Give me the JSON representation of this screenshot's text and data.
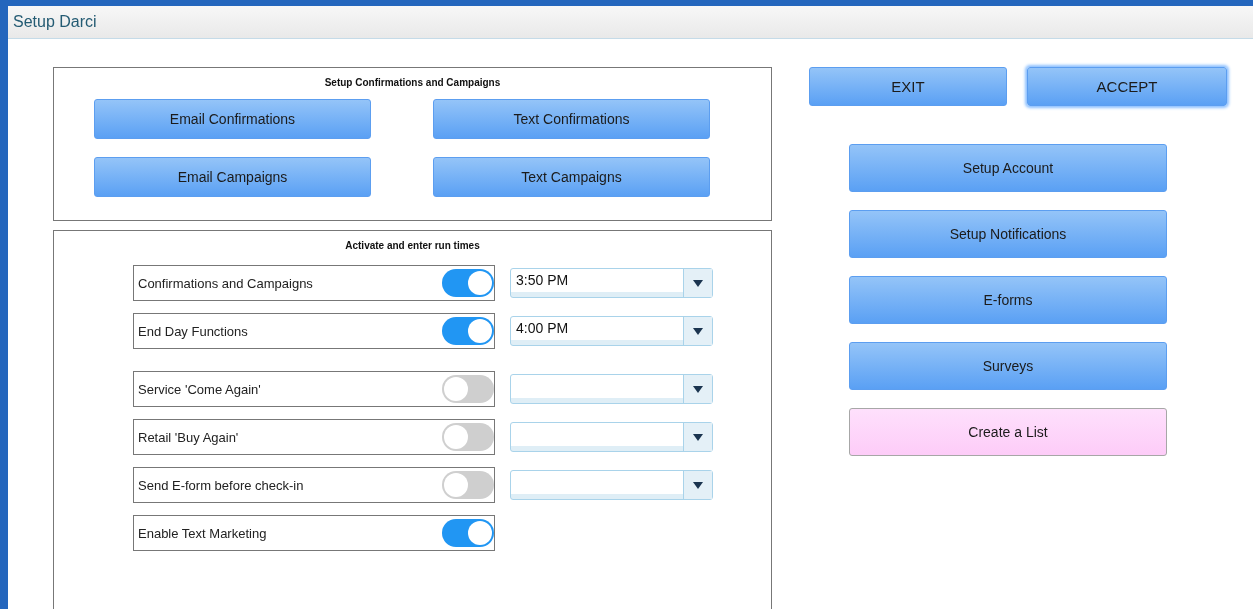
{
  "window": {
    "title": "Setup Darci"
  },
  "campaigns_panel": {
    "title": "Setup Confirmations and Campaigns",
    "buttons": [
      "Email Confirmations",
      "Text Confirmations",
      "Email Campaigns",
      "Text Campaigns"
    ]
  },
  "run_times_panel": {
    "title": "Activate and enter run times",
    "groups": [
      [
        {
          "label": "Confirmations and Campaigns",
          "on": true,
          "kind": "timed",
          "time": "3:50 PM"
        },
        {
          "label": "End Day Functions",
          "on": true,
          "kind": "timed",
          "time": "4:00 PM"
        }
      ],
      [
        {
          "label": "Service 'Come Again'",
          "on": false,
          "kind": "timed"
        },
        {
          "label": "Retail 'Buy Again'",
          "on": false,
          "kind": "timed"
        },
        {
          "label": "Send E-form before check-in",
          "on": false,
          "kind": "timed"
        },
        {
          "label": "Enable Text Marketing",
          "on": true,
          "kind": "plain"
        }
      ]
    ]
  },
  "top_buttons": [
    {
      "label": "EXIT",
      "focused": false
    },
    {
      "label": "ACCEPT",
      "focused": true
    }
  ],
  "menu_buttons": [
    {
      "label": "Setup Account",
      "kind": "blue"
    },
    {
      "label": "Setup Notifications",
      "kind": "blue"
    },
    {
      "label": "E-forms",
      "kind": "blue"
    },
    {
      "label": "Surveys",
      "kind": "blue"
    },
    {
      "label": "Create a List",
      "kind": "pink"
    }
  ]
}
